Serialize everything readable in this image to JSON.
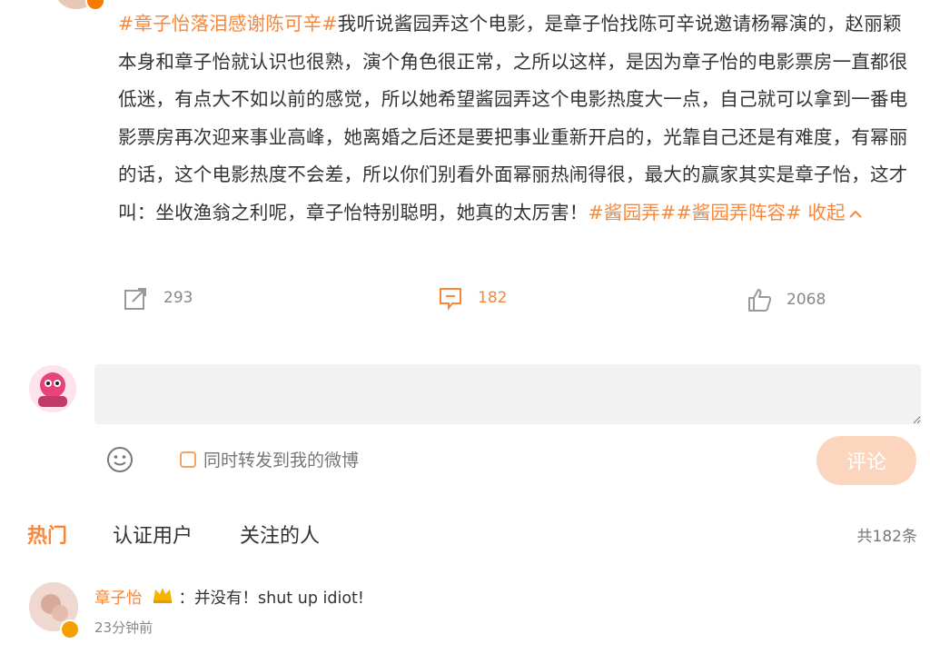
{
  "post": {
    "topic1": "#章子怡落泪感谢陈可辛#",
    "body": "我听说酱园弄这个电影，是章子怡找陈可辛说邀请杨幂演的，赵丽颖本身和章子怡就认识也很熟，演个角色很正常，之所以这样，是因为章子怡的电影票房一直都很低迷，有点大不如以前的感觉，所以她希望酱园弄这个电影热度大一点，自己就可以拿到一番电影票房再次迎来事业高峰，她离婚之后还是要把事业重新开启的，光靠自己还是有难度，有幂丽的话，这个电影热度不会差，所以你们别看外面幂丽热闹得很，最大的赢家其实是章子怡，这才叫：坐收渔翁之利呢，章子怡特别聪明，她真的太厉害！",
    "topic2": "#酱园弄#",
    "topic3": "#酱园弄阵容#",
    "collapse_label": "收起"
  },
  "actions": {
    "repost_count": "293",
    "comment_count": "182",
    "like_count": "2068"
  },
  "composer": {
    "repost_option_label": "同时转发到我的微博",
    "submit_label": "评论"
  },
  "comments_header": {
    "tabs": [
      "热门",
      "认证用户",
      "关注的人"
    ],
    "total": "共182条"
  },
  "comments": [
    {
      "user": "章子怡",
      "text": "：并没有！shut up idiot!",
      "time": "23分钟前"
    }
  ],
  "colors": {
    "accent": "#f7873a",
    "submit_disabled": "#fbd5bd",
    "input_bg": "#f2f2f2"
  }
}
